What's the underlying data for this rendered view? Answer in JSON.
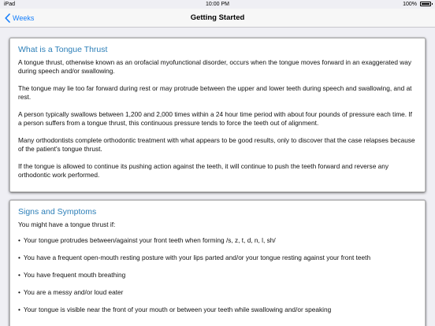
{
  "status_bar": {
    "carrier": "iPad",
    "time": "10:00 PM",
    "battery": "100%"
  },
  "nav": {
    "back_label": "Weeks",
    "title": "Getting Started"
  },
  "sections": [
    {
      "title": "What is a Tongue Thrust",
      "paragraphs": [
        "A tongue thrust, otherwise known as an orofacial myofunctional disorder, occurs when the tongue moves forward in an exaggerated way during speech and/or swallowing.",
        "The tongue may lie too far forward during rest or may protrude between the upper and lower teeth during speech and swallowing, and at rest.",
        "A person typically swallows between 1,200 and 2,000 times within a 24 hour time period with about four pounds of pressure each time. If a person suffers from a tongue thrust, this continuous pressure tends to force the teeth out of alignment.",
        "Many orthodontists complete orthodontic treatment with what appears to be good results, only to discover that the case relapses because of the patient's tongue thrust.",
        "If the tongue is allowed to continue its pushing action against the teeth, it will continue to push the teeth forward and reverse any orthodontic work performed."
      ]
    },
    {
      "title": "Signs and Symptoms",
      "intro": "You might have a tongue thrust if:",
      "bullets": [
        "Your tongue protrudes between/against your front teeth when forming /s, z, t, d, n, l, sh/",
        "You have a frequent open-mouth resting posture with your lips parted and/or your tongue resting against your front teeth",
        "You have frequent mouth breathing",
        "You are a messy and/or loud eater",
        "Your tongue is visible near the front of your mouth or between your teeth while swallowing and/or speaking"
      ]
    }
  ],
  "bullet_char": "•",
  "colors": {
    "accent": "#147efb",
    "heading": "#2c7fb8",
    "background": "#efeff4"
  }
}
